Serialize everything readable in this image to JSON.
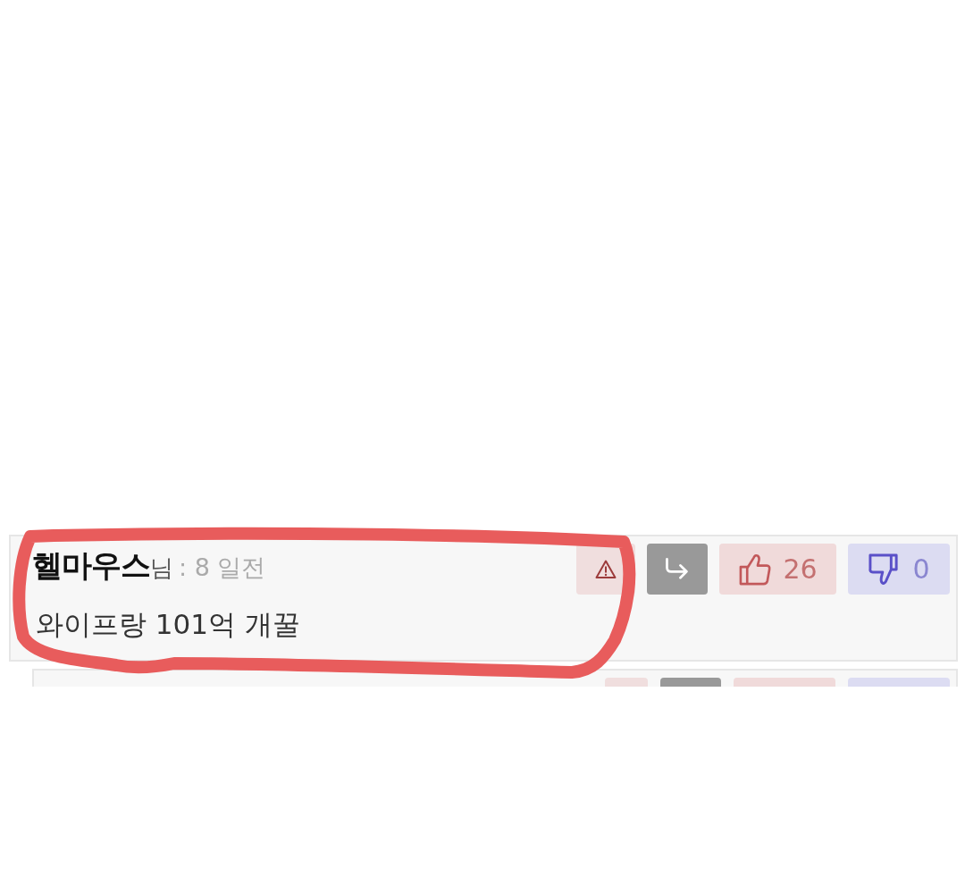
{
  "comments": [
    {
      "author": "헬마우스",
      "honorific": "님",
      "time": ": 8 일전",
      "text": "와이프랑 101억 개꿀",
      "likes": "26",
      "dislikes": "0",
      "cut_off": false
    },
    {
      "cut_off": true
    }
  ],
  "markup": {
    "kind": "loop"
  }
}
